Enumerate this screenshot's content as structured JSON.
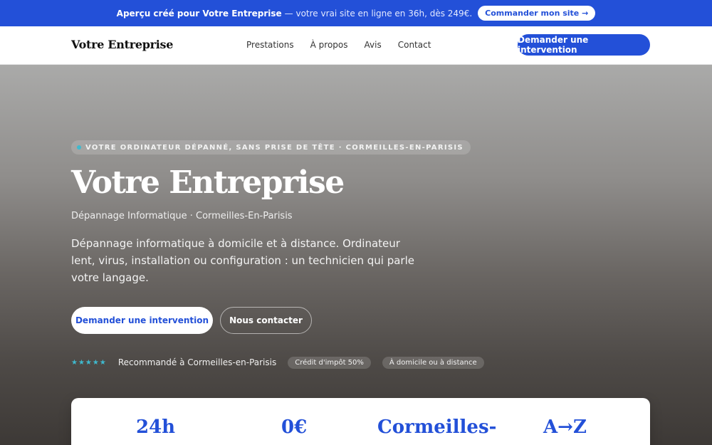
{
  "promo": {
    "strong": "Aperçu créé pour Votre Entreprise",
    "light": "— votre vrai site en ligne en 36h, dès 249€.",
    "cta": "Commander mon site →"
  },
  "nav": {
    "brand": "Votre Entreprise",
    "items": [
      "Prestations",
      "À propos",
      "Avis",
      "Contact"
    ],
    "cta": "Demander une intervention"
  },
  "hero": {
    "tagline": "VOTRE ORDINATEUR DÉPANNÉ, SANS PRISE DE TÊTE · CORMEILLES-EN-PARISIS",
    "title": "Votre Entreprise",
    "subtitle": "Dépannage Informatique · Cormeilles-En-Parisis",
    "description": "Dépannage informatique à domicile et à distance. Ordinateur lent, virus, installation ou configuration : un technicien qui parle votre langage.",
    "primary_cta": "Demander une intervention",
    "secondary_cta": "Nous contacter",
    "rating_stars": "★★★★★",
    "trust_text": "Recommandé à Cormeilles-en-Parisis",
    "chips": [
      "Crédit d'impôt 50%",
      "À domicile ou à distance"
    ]
  },
  "stats": [
    "24h",
    "0€",
    "Cormeilles-",
    "A→Z"
  ],
  "colors": {
    "accent": "#2350d8",
    "teal": "#3fb9ce"
  }
}
